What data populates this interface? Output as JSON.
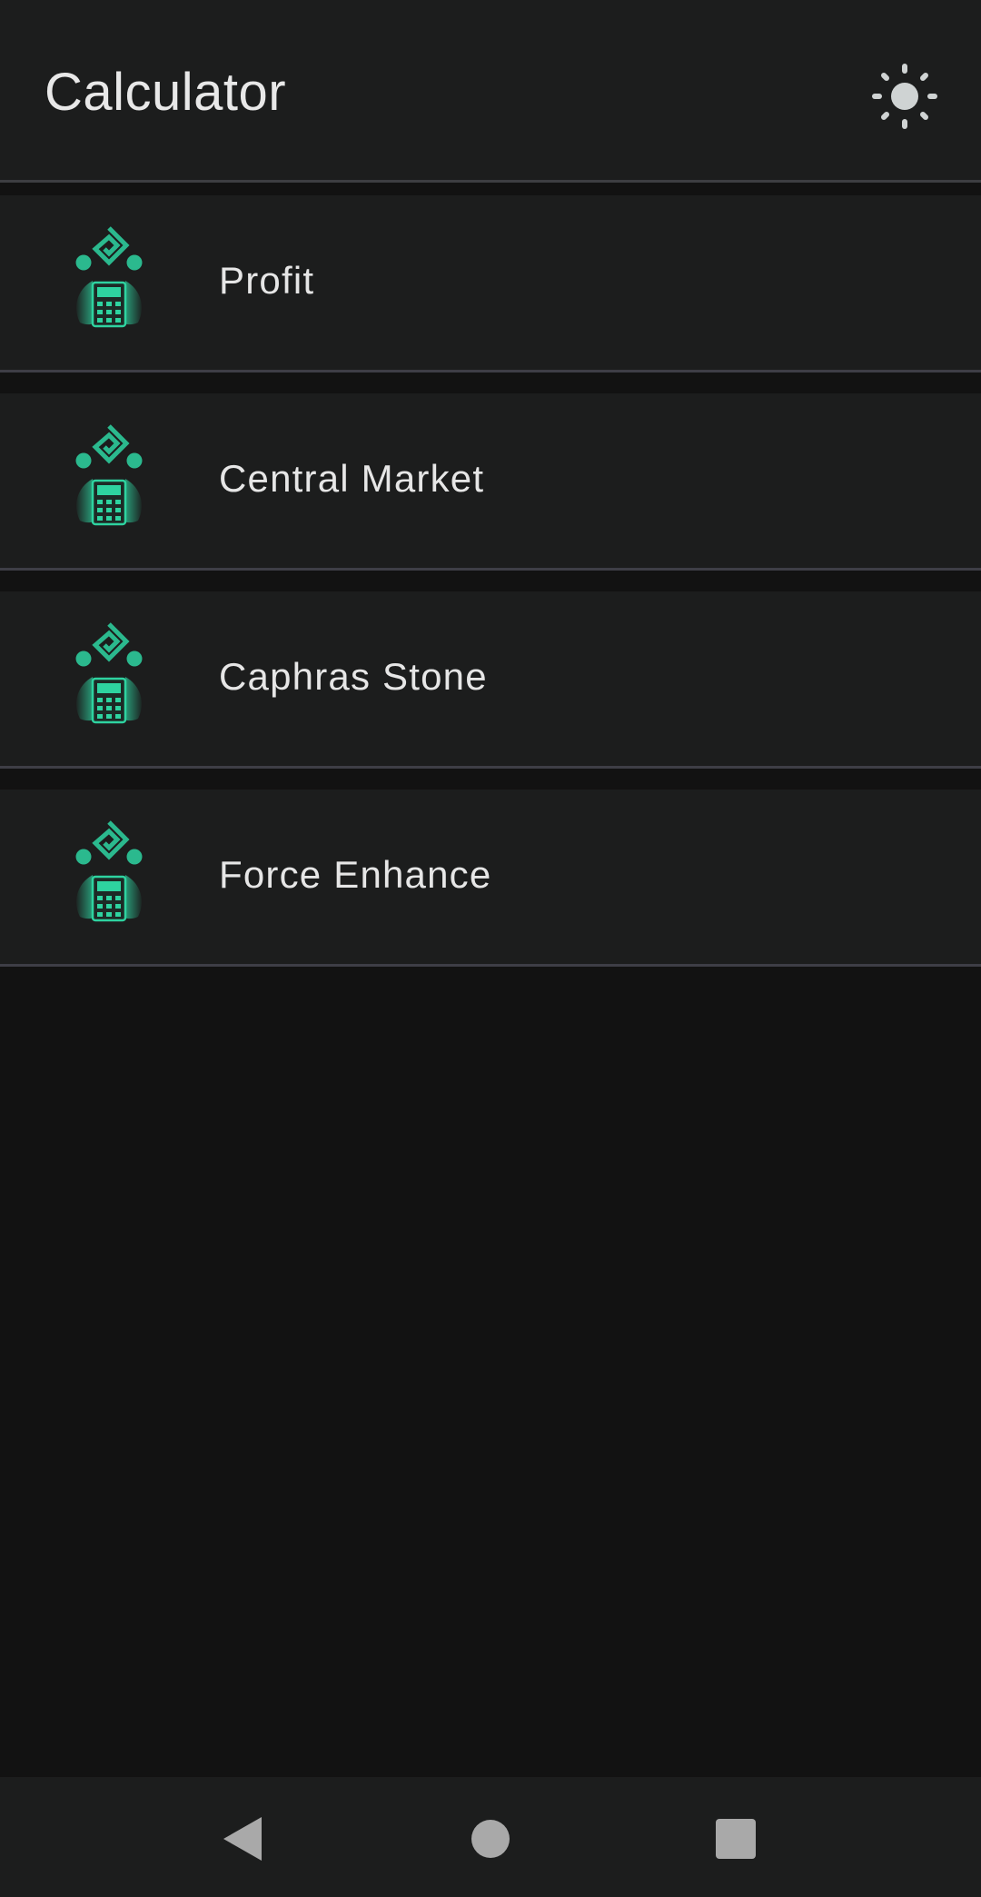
{
  "app_bar": {
    "title": "Calculator",
    "theme_toggle_icon": "sun-icon"
  },
  "menu": {
    "items": [
      {
        "label": "Profit",
        "icon": "calculator-logo-icon"
      },
      {
        "label": "Central Market",
        "icon": "calculator-logo-icon"
      },
      {
        "label": "Caphras Stone",
        "icon": "calculator-logo-icon"
      },
      {
        "label": "Force Enhance",
        "icon": "calculator-logo-icon"
      }
    ]
  },
  "nav_bar": {
    "back_icon": "back-triangle-icon",
    "home_icon": "home-circle-icon",
    "recents_icon": "recents-square-icon"
  },
  "colors": {
    "background": "#121212",
    "surface": "#1c1d1d",
    "divider": "#3e3e46",
    "accent": "#2ed3a0",
    "text": "#e6e6e6",
    "nav_icon": "#a9a9a9"
  }
}
